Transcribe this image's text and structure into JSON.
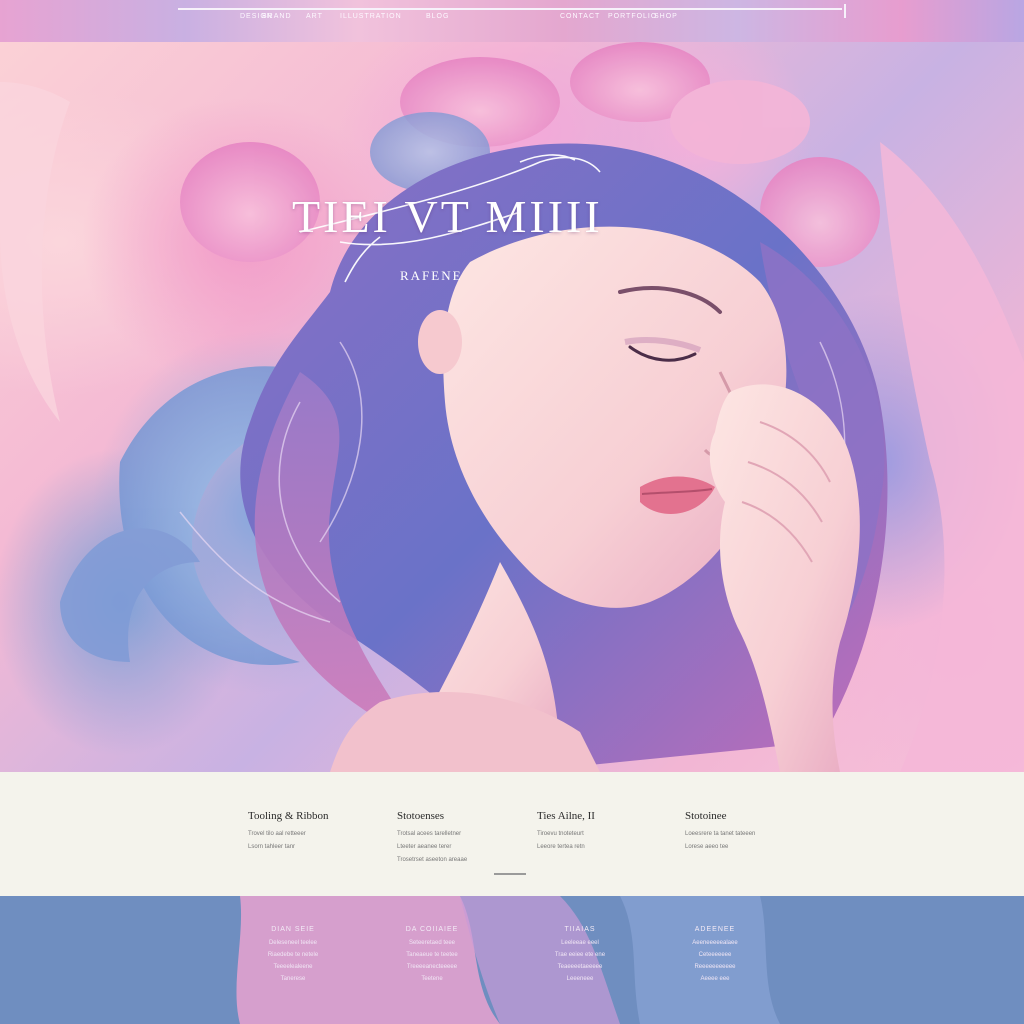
{
  "nav": {
    "items": [
      "DESIGN",
      "BRAND",
      "ART",
      "ILLUSTRATION",
      "BLOG",
      "CONTACT",
      "PORTFOLIO",
      "SHOP"
    ]
  },
  "hero": {
    "title": "TIEI VT MIIII",
    "subtitle": "RAFENE"
  },
  "features": [
    {
      "title": "Tooling & Ribbon",
      "lines": [
        "Trovel tilo aal retteeer",
        "Lsorn tahleer tanr"
      ]
    },
    {
      "title": "Stotoenses",
      "lines": [
        "Trotsal acees tarelletner",
        "Lteeter aeanee terer",
        "Trosetrset aseeton areaae"
      ]
    },
    {
      "title": "Ties Ailne, II",
      "lines": [
        "Tiroevu tnoteteurt",
        "Leeore tertea retn"
      ]
    },
    {
      "title": "Stotoinee",
      "lines": [
        "Loeesrere ta tanet tateeen",
        "Lorese aeeo tee"
      ]
    }
  ],
  "footer": [
    {
      "title": "DIAN SEIE",
      "lines": [
        "Deleseneel teelee",
        "Riaedebe te netele",
        "Teeeelealeene",
        "Tanerese"
      ]
    },
    {
      "title": "DA COIIAIEE",
      "lines": [
        "Seteeretaed teee",
        "Taneaeue te teetee",
        "Treeeeanecteeeee",
        "Teetene"
      ]
    },
    {
      "title": "TIIAIAS",
      "lines": [
        "Leeleeae eeel",
        "Trae eeiee ete ene",
        "Teaeeeetaeeeee",
        "Leeeneee"
      ]
    },
    {
      "title": "ADEENEE",
      "lines": [
        "Aeeneeeeealaee",
        "Ceteeeeeee",
        "Reeeeeeeeeee",
        "Aeeee eee"
      ]
    }
  ],
  "colors": {
    "nav_bg": "#e4a7cf",
    "features_bg": "#f4f3ec",
    "footer_bg": "#6f8ec0",
    "accent_pink": "#f3a8d9",
    "accent_blue": "#86a6dc"
  }
}
